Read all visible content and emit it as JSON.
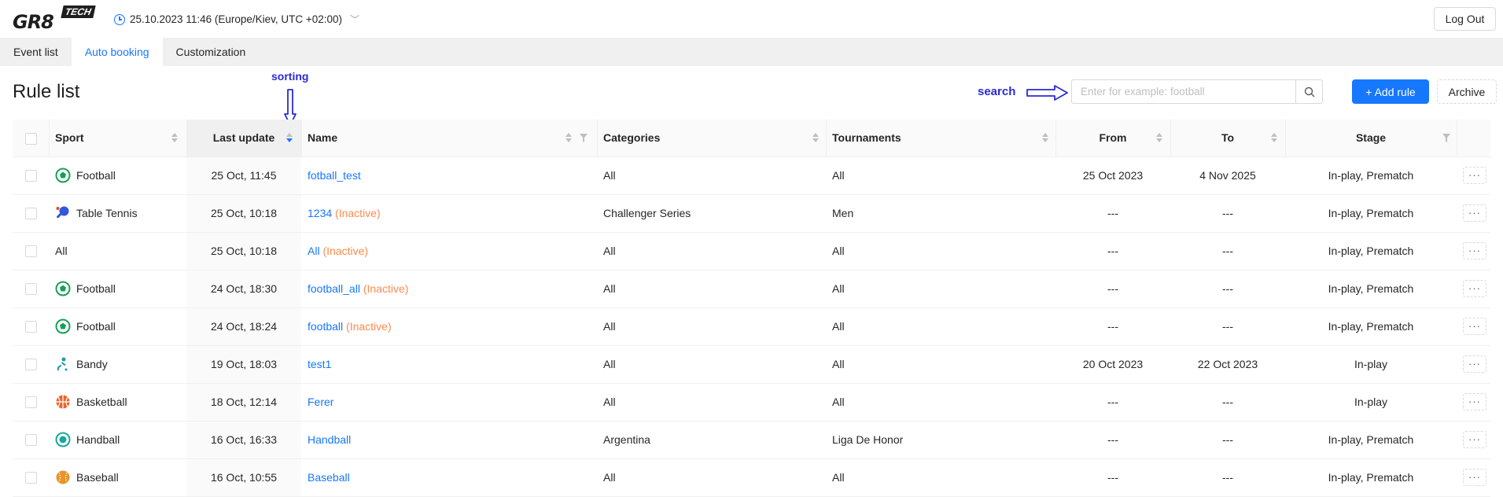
{
  "header": {
    "logo_main": "GR8",
    "logo_tech": "TECH",
    "datetime": "25.10.2023 11:46 (Europe/Kiev, UTC +02:00)",
    "logout_label": "Log Out"
  },
  "tabs": [
    {
      "label": "Event list",
      "active": false
    },
    {
      "label": "Auto booking",
      "active": true
    },
    {
      "label": "Customization",
      "active": false
    }
  ],
  "page": {
    "title": "Rule list",
    "annotation_sorting": "sorting",
    "annotation_search": "search",
    "search_placeholder": "Enter for example: football",
    "add_rule_label": "+ Add rule",
    "archive_label": "Archive"
  },
  "table": {
    "columns": [
      "Sport",
      "Last update",
      "Name",
      "Categories",
      "Tournaments",
      "From",
      "To",
      "Stage"
    ],
    "rows": [
      {
        "sport": "Football",
        "icon": "football-icon",
        "last_update": "25 Oct, 11:45",
        "name": "fotball_test",
        "status": "",
        "categories": "All",
        "tournaments": "All",
        "from": "25 Oct 2023",
        "to": "4 Nov 2025",
        "stage": "In-play, Prematch"
      },
      {
        "sport": "Table Tennis",
        "icon": "table-tennis-icon",
        "last_update": "25 Oct, 10:18",
        "name": "1234",
        "status": "(Inactive)",
        "categories": "Challenger Series",
        "tournaments": "Men",
        "from": "---",
        "to": "---",
        "stage": "In-play, Prematch"
      },
      {
        "sport": "All",
        "icon": "",
        "last_update": "25 Oct, 10:18",
        "name": "All",
        "status": "(Inactive)",
        "categories": "All",
        "tournaments": "All",
        "from": "---",
        "to": "---",
        "stage": "In-play, Prematch"
      },
      {
        "sport": "Football",
        "icon": "football-icon",
        "last_update": "24 Oct, 18:30",
        "name": "football_all",
        "status": "(Inactive)",
        "categories": "All",
        "tournaments": "All",
        "from": "---",
        "to": "---",
        "stage": "In-play, Prematch"
      },
      {
        "sport": "Football",
        "icon": "football-icon",
        "last_update": "24 Oct, 18:24",
        "name": "football",
        "status": "(Inactive)",
        "categories": "All",
        "tournaments": "All",
        "from": "---",
        "to": "---",
        "stage": "In-play, Prematch"
      },
      {
        "sport": "Bandy",
        "icon": "bandy-icon",
        "last_update": "19 Oct, 18:03",
        "name": "test1",
        "status": "",
        "categories": "All",
        "tournaments": "All",
        "from": "20 Oct 2023",
        "to": "22 Oct 2023",
        "stage": "In-play"
      },
      {
        "sport": "Basketball",
        "icon": "basketball-icon",
        "last_update": "18 Oct, 12:14",
        "name": "Ferer",
        "status": "",
        "categories": "All",
        "tournaments": "All",
        "from": "---",
        "to": "---",
        "stage": "In-play"
      },
      {
        "sport": "Handball",
        "icon": "handball-icon",
        "last_update": "16 Oct, 16:33",
        "name": "Handball",
        "status": "",
        "categories": "Argentina",
        "tournaments": "Liga De Honor",
        "from": "---",
        "to": "---",
        "stage": "In-play, Prematch"
      },
      {
        "sport": "Baseball",
        "icon": "baseball-icon",
        "last_update": "16 Oct, 10:55",
        "name": "Baseball",
        "status": "",
        "categories": "All",
        "tournaments": "All",
        "from": "---",
        "to": "---",
        "stage": "In-play, Prematch"
      }
    ],
    "row_action_label": "···"
  },
  "colors": {
    "accent": "#1677ff",
    "inactive": "#ff8a4c",
    "annotation": "#2b2bd6",
    "football": "#18a058",
    "table_tennis": "#3355dd",
    "bandy": "#1f9aa8",
    "basketball": "#e8662c",
    "handball": "#1aa89a",
    "baseball": "#e8942c"
  }
}
